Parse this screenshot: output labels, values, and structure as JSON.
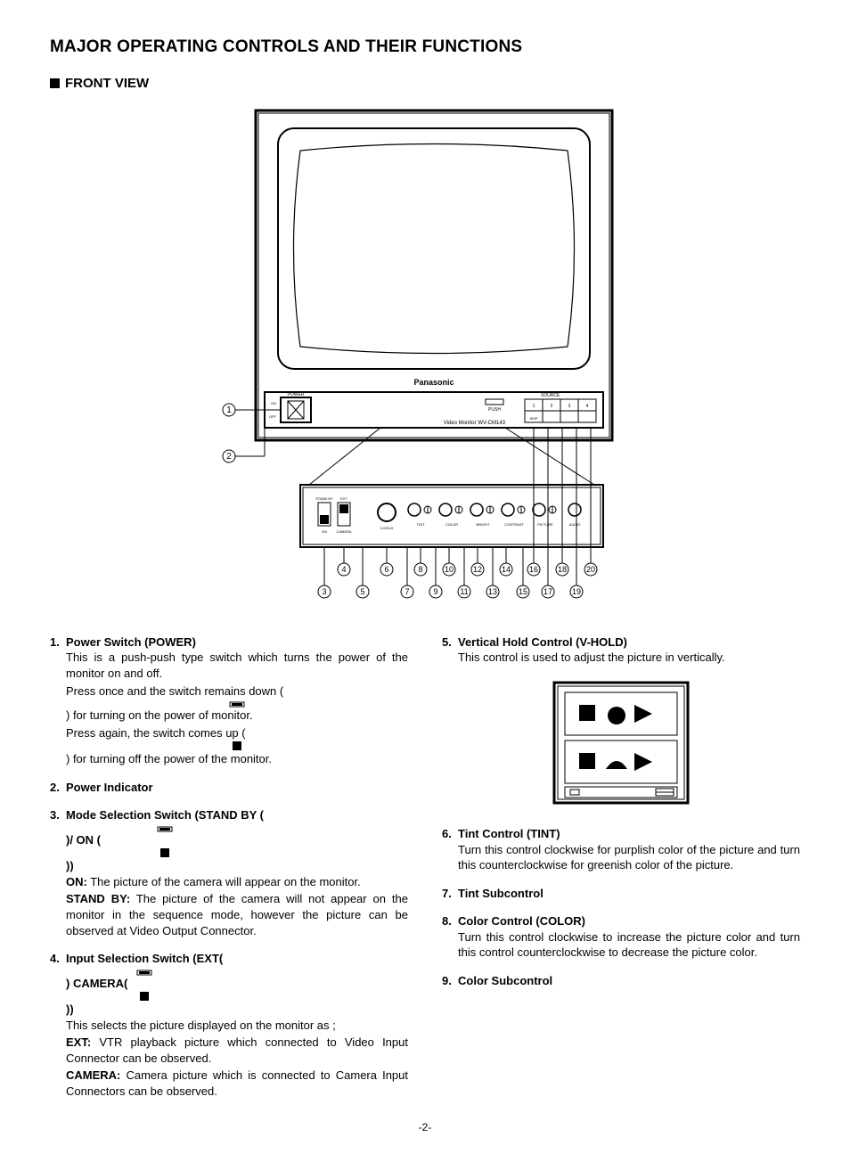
{
  "title": "MAJOR OPERATING CONTROLS AND THEIR FUNCTIONS",
  "subheading": "FRONT VIEW",
  "diagram": {
    "brand": "Panasonic",
    "model_line": "Video Monitor WV-CM143",
    "power_label": "POWER",
    "on_label": "ON",
    "off_label": "OFF",
    "push_label": "PUSH",
    "source_label": "SOURCE",
    "source_nums": [
      "1",
      "2",
      "3",
      "4"
    ],
    "source_skip": "SKIP",
    "stand_by": "STAND BY",
    "ctrl_on": "ON",
    "ctrl_ext": "EXT",
    "ctrl_camera": "CAMERA",
    "dials": [
      "V-HOLD",
      "TINT",
      "COLOR",
      "BRIGHT",
      "CONTRAST",
      "PICTURE",
      "AUDIO"
    ],
    "callouts_top": [
      "1",
      "2"
    ],
    "callouts_row1": [
      "4",
      "6",
      "8",
      "10",
      "12",
      "14",
      "16",
      "18",
      "20"
    ],
    "callouts_row2": [
      "3",
      "5",
      "7",
      "9",
      "11",
      "13",
      "15",
      "17",
      "19"
    ]
  },
  "left": {
    "i1": {
      "num": "1.",
      "title": "Power Switch (POWER)",
      "p1": "This is a push-push type switch which turns the power of the monitor on and off.",
      "p2a": "Press once and the switch remains down (",
      "p2b": ") for turning on the power of monitor.",
      "p3a": "Press again, the switch comes up (",
      "p3b": ") for turning off the power of the monitor."
    },
    "i2": {
      "num": "2.",
      "title": "Power Indicator"
    },
    "i3": {
      "num": "3.",
      "titleA": "Mode Selection Switch (STAND BY (",
      "titleB": ")/ ON (",
      "titleC": "))",
      "on_lead": "ON:",
      "on_txt": " The picture of the camera will appear on the monitor.",
      "sb_lead": "STAND BY:",
      "sb_txt": " The picture of the camera will not appear on the monitor in the sequence mode, however the picture can be observed at Video Output Connector."
    },
    "i4": {
      "num": "4.",
      "titleA": "Input Selection Switch (EXT(",
      "titleB": ") CAMERA(",
      "titleC": "))",
      "intro": "This selects the picture displayed on the monitor as ;",
      "ext_lead": "EXT:",
      "ext_txt": " VTR playback picture which connected to Video Input Connector can be observed.",
      "cam_lead": "CAMERA:",
      "cam_txt": " Camera picture which is connected to Camera Input Connectors can be observed."
    }
  },
  "right": {
    "i5": {
      "num": "5.",
      "title": "Vertical Hold Control (V-HOLD)",
      "p1": "This control is used to adjust the picture in vertically."
    },
    "i6": {
      "num": "6.",
      "title": "Tint Control (TINT)",
      "p1": "Turn this control clockwise for purplish color of the picture and turn this counterclockwise for greenish color of the picture."
    },
    "i7": {
      "num": "7.",
      "title": "Tint Subcontrol"
    },
    "i8": {
      "num": "8.",
      "title": "Color Control (COLOR)",
      "p1": "Turn this control clockwise to increase the picture color and turn this control counterclockwise to decrease the picture color."
    },
    "i9": {
      "num": "9.",
      "title": "Color Subcontrol"
    }
  },
  "page": "-2-"
}
